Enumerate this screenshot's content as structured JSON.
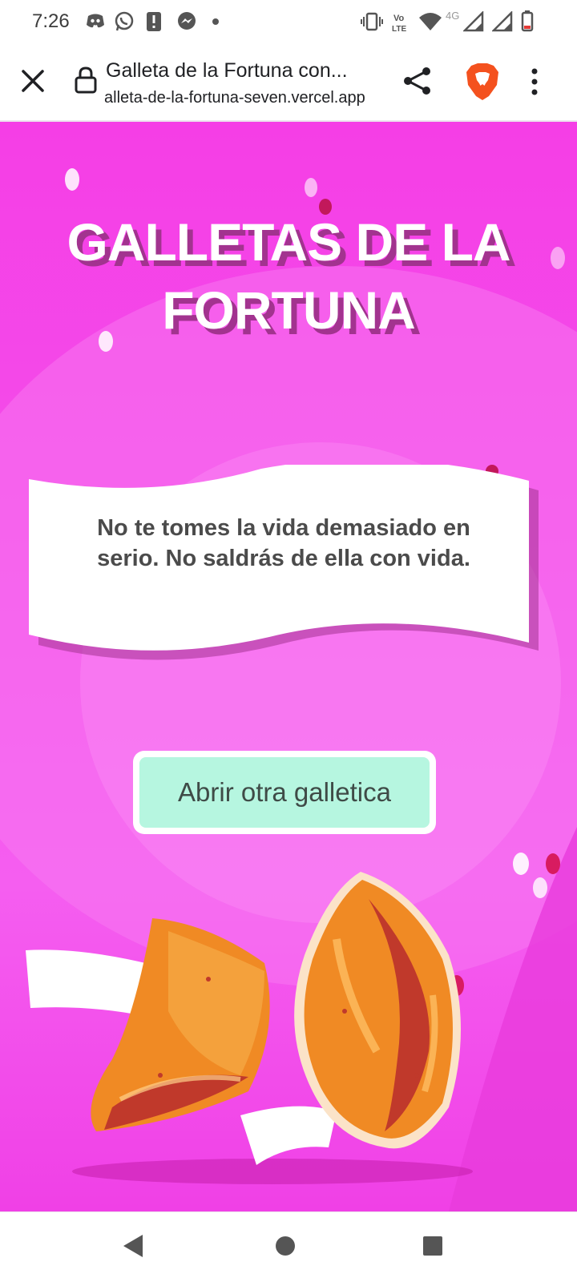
{
  "status_bar": {
    "time": "7:26",
    "network_label": "4G",
    "icons": [
      "discord-icon",
      "whatsapp-icon",
      "alert-icon",
      "messenger-icon",
      "dot-icon",
      "vibrate-icon",
      "volte-icon",
      "wifi-icon",
      "signal-icon",
      "signal-icon",
      "battery-icon"
    ]
  },
  "browser": {
    "page_title": "Galleta de la Fortuna con...",
    "url": "alleta-de-la-fortuna-seven.vercel.app",
    "icons": [
      "close-icon",
      "lock-icon",
      "share-icon",
      "brave-lion-icon",
      "more-vert-icon"
    ]
  },
  "page": {
    "title": "GALLETAS DE LA FORTUNA",
    "fortune_text": "No te tomes la vida demasiado en serio. No saldrás de ella con vida.",
    "button_label": "Abrir otra galletica",
    "colors": {
      "background": "#f53ee6",
      "title_shadow": "#a2338f",
      "button_bg": "#b6f6e0",
      "cookie_orange": "#f08a24"
    }
  },
  "nav": {
    "icons": [
      "back-icon",
      "home-icon",
      "recents-icon"
    ]
  }
}
